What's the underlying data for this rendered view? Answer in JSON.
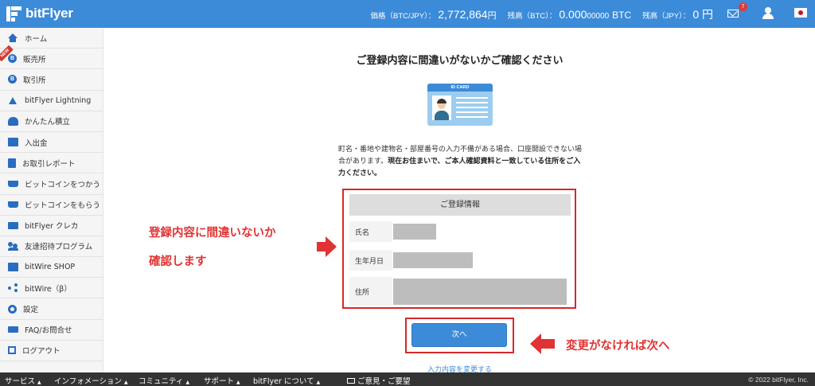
{
  "header": {
    "brand": "bitFlyer",
    "price_label": "価格（BTC/JPY）：",
    "price_value": "2,772,864",
    "price_unit": "円",
    "btc_label": "残高（BTC）：",
    "btc_value_main": "0.000",
    "btc_value_small": "00000",
    "btc_unit": "BTC",
    "jpy_label": "残高（JPY）：",
    "jpy_value": "0 円",
    "mail_badge": "7"
  },
  "sidebar": {
    "new_ribbon": "NEW",
    "items": [
      {
        "label": "ホーム",
        "icon": "home-icon"
      },
      {
        "label": "販売所",
        "icon": "coin-icon"
      },
      {
        "label": "取引所",
        "icon": "coin-icon"
      },
      {
        "label": "bitFlyer Lightning",
        "icon": "lightning-icon"
      },
      {
        "label": "かんたん積立",
        "icon": "piggy-icon"
      },
      {
        "label": "入出金",
        "icon": "wallet-icon"
      },
      {
        "label": "お取引レポート",
        "icon": "report-icon"
      },
      {
        "label": "ビットコインをつかう",
        "icon": "cart-icon"
      },
      {
        "label": "ビットコインをもらう",
        "icon": "cart-icon"
      },
      {
        "label": "bitFlyer クレカ",
        "icon": "card-icon"
      },
      {
        "label": "友達招待プログラム",
        "icon": "friends-icon"
      },
      {
        "label": "bitWire SHOP",
        "icon": "shop-icon"
      },
      {
        "label": "bitWire（β）",
        "icon": "share-icon"
      },
      {
        "label": "設定",
        "icon": "gear-icon"
      },
      {
        "label": "FAQ/お問合せ",
        "icon": "mail-icon"
      },
      {
        "label": "ログアウト",
        "icon": "logout-icon"
      }
    ],
    "coin_glyph": "B"
  },
  "main": {
    "title": "ご登録内容に間違いがないかご確認ください",
    "id_card_label": "ID CARD",
    "description_normal": "町名・番地や建物名・部屋番号の入力不備がある場合、口座開設できない場合があります。",
    "description_bold": "現在お住まいで、ご本人確認資料と一致している住所をご入力ください。",
    "info_header": "ご登録情報",
    "fields": {
      "name": "氏名",
      "birthdate": "生年月日",
      "address": "住所"
    },
    "callout_left_line1": "登録内容に間違いないか",
    "callout_left_line2": "確認します",
    "next_button": "次へ",
    "callout_right": "変更がなければ次へ",
    "change_link": "入力内容を変更する"
  },
  "footer": {
    "service": "サービス",
    "info": "インフォメーション",
    "community": "コミュニティ",
    "support": "サポート",
    "about": "bitFlyer について",
    "feedback": "ご意見・ご要望",
    "copyright": "© 2022 bitFlyer, Inc.",
    "caret": "▲"
  },
  "colors": {
    "brand_blue": "#3c8bd9",
    "highlight_red": "#d42a2a"
  }
}
